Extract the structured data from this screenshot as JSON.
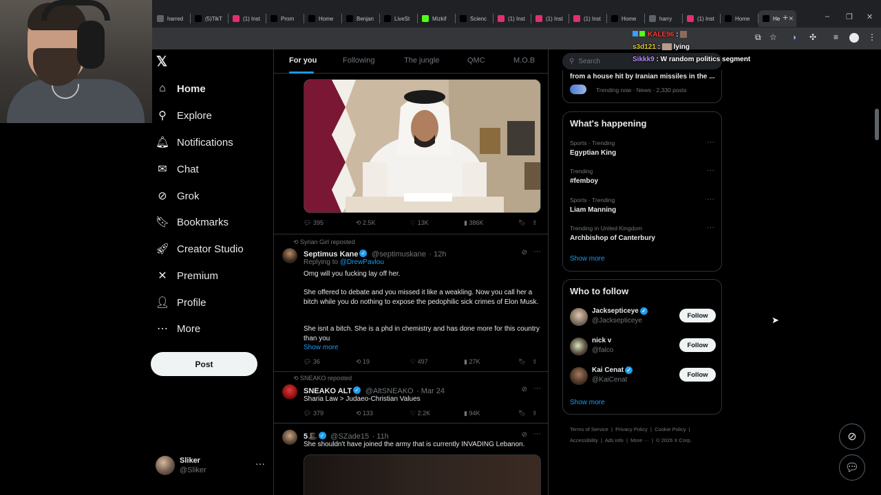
{
  "browser": {
    "tabs": [
      {
        "label": "harred",
        "icon": "tab-icon",
        "color": "#5f6368"
      },
      {
        "label": "(5)TikT",
        "icon": "tiktok-icon",
        "color": "#000000"
      },
      {
        "label": "(1) Inst",
        "icon": "instagram-icon",
        "color": "#e1306c"
      },
      {
        "label": "Prom",
        "icon": "tiktok-icon",
        "color": "#000000"
      },
      {
        "label": "Home",
        "icon": "x-icon",
        "color": "#000000"
      },
      {
        "label": "Benjan",
        "icon": "tiktok-icon",
        "color": "#000000"
      },
      {
        "label": "LiveSt",
        "icon": "x-icon",
        "color": "#000000"
      },
      {
        "label": "Mizkif",
        "icon": "kick-icon",
        "color": "#53fc18"
      },
      {
        "label": "Scienc",
        "icon": "x-icon",
        "color": "#000000"
      },
      {
        "label": "(1) Inst",
        "icon": "instagram-icon",
        "color": "#e1306c"
      },
      {
        "label": "(1) Inst",
        "icon": "instagram-icon",
        "color": "#e1306c"
      },
      {
        "label": "(1) Inst",
        "icon": "instagram-icon",
        "color": "#e1306c"
      },
      {
        "label": "Home",
        "icon": "x-icon",
        "color": "#000000"
      },
      {
        "label": "harry",
        "icon": "globe-icon",
        "color": "#5f6368"
      },
      {
        "label": "(1) Inst",
        "icon": "instagram-icon",
        "color": "#e1306c"
      },
      {
        "label": "Home",
        "icon": "x-icon",
        "color": "#000000"
      },
      {
        "label": "He",
        "icon": "x-icon",
        "color": "#000000",
        "active": true
      }
    ],
    "new_tab": "+",
    "minimize": "–",
    "restore": "❐",
    "close": "✕"
  },
  "chat_overlay": [
    {
      "user": "KALE96",
      "message": "",
      "color": "#ff3b3b"
    },
    {
      "user": "s3d121",
      "message": "lying",
      "color": "#d8c531"
    },
    {
      "user": "Sikkk9",
      "message": "W random politics segment",
      "color": "#b98bff"
    }
  ],
  "nav": {
    "logo": "𝕏",
    "items": [
      {
        "label": "Home",
        "icon": "home-icon",
        "glyph": "⌂",
        "active": true
      },
      {
        "label": "Explore",
        "icon": "search-icon",
        "glyph": "⚲"
      },
      {
        "label": "Notifications",
        "icon": "bell-icon",
        "glyph": "🔔︎"
      },
      {
        "label": "Chat",
        "icon": "mail-icon",
        "glyph": "✉"
      },
      {
        "label": "Grok",
        "icon": "grok-icon",
        "glyph": "⊘"
      },
      {
        "label": "Bookmarks",
        "icon": "bookmark-icon",
        "glyph": "🔖︎"
      },
      {
        "label": "Creator Studio",
        "icon": "rocket-icon",
        "glyph": "🚀︎"
      },
      {
        "label": "Premium",
        "icon": "x-icon",
        "glyph": "✕"
      },
      {
        "label": "Profile",
        "icon": "person-icon",
        "glyph": "👤︎"
      },
      {
        "label": "More",
        "icon": "more-circle-icon",
        "glyph": "⋯"
      }
    ],
    "post_label": "Post",
    "account": {
      "name": "Sliker",
      "handle": "@Sliker",
      "more": "···"
    }
  },
  "feed": {
    "tabs": [
      "For you",
      "Following",
      "The jungle",
      "QMC",
      "M.O.B"
    ],
    "active_tab": "For you",
    "posts": [
      {
        "stats": {
          "replies": "395",
          "reposts": "2.5K",
          "likes": "13K",
          "views": "386K"
        }
      },
      {
        "reposted_by": "Syrian Girl reposted",
        "name": "Septimus Kane",
        "handle": "@septimuskane",
        "time": "· 12h",
        "replying_to_prefix": "Replying to ",
        "replying_to": "@DrewPavlou",
        "paragraphs": [
          "Omg will you fucking lay off her.",
          "She offered to debate and you missed it like a weakling. Now you call her a bitch while you do nothing to expose the pedophilic sick crimes of Elon Musk.",
          "She isnt a bitch. She is a phd in chemistry and has done more for this country than you"
        ],
        "show_more": "Show more",
        "stats": {
          "replies": "36",
          "reposts": "19",
          "likes": "497",
          "views": "27K"
        }
      },
      {
        "reposted_by": "SNEAKO reposted",
        "name": "SNEAKO ALT",
        "handle": "@AltSNEAKO",
        "time": "· Mar 24",
        "text": "Sharia Law > Judaeo-Christian Values",
        "stats": {
          "replies": "379",
          "reposts": "133",
          "likes": "2.2K",
          "views": "94K"
        }
      },
      {
        "name": "5🎩",
        "handle": "@SZade15",
        "time": "· 11h",
        "text": "She shouldn't have joined the army that is currently INVADING Lebanon."
      }
    ]
  },
  "right": {
    "search_placeholder": "Search",
    "top_news": {
      "headline": "from a house hit by Iranian missiles in the ...",
      "meta": "Trending now · News · 2,330 posts"
    },
    "happening": {
      "title": "What's happening",
      "trends": [
        {
          "meta": "Sports · Trending",
          "title": "Egyptian King"
        },
        {
          "meta": "Trending",
          "title": "#femboy"
        },
        {
          "meta": "Sports · Trending",
          "title": "Liam Manning"
        },
        {
          "meta": "Trending in United Kingdom",
          "title": "Archbishop of Canterbury"
        }
      ],
      "show_more": "Show more"
    },
    "who_to_follow": {
      "title": "Who to follow",
      "users": [
        {
          "name": "Jacksepticeye",
          "handle": "@Jacksepticeye",
          "verified": true,
          "button": "Follow"
        },
        {
          "name": "nick v",
          "handle": "@falco",
          "verified": false,
          "button": "Follow"
        },
        {
          "name": "Kai Cenat",
          "handle": "@KaiCenat",
          "verified": true,
          "button": "Follow"
        }
      ],
      "show_more": "Show more"
    },
    "footer": [
      "Terms of Service",
      "Privacy Policy",
      "Cookie Policy",
      "Accessibility",
      "Ads info",
      "More ···",
      "© 2026 X Corp."
    ]
  },
  "colors": {
    "accent": "#1d9bf0",
    "background": "#000000",
    "border": "#2f3336"
  }
}
